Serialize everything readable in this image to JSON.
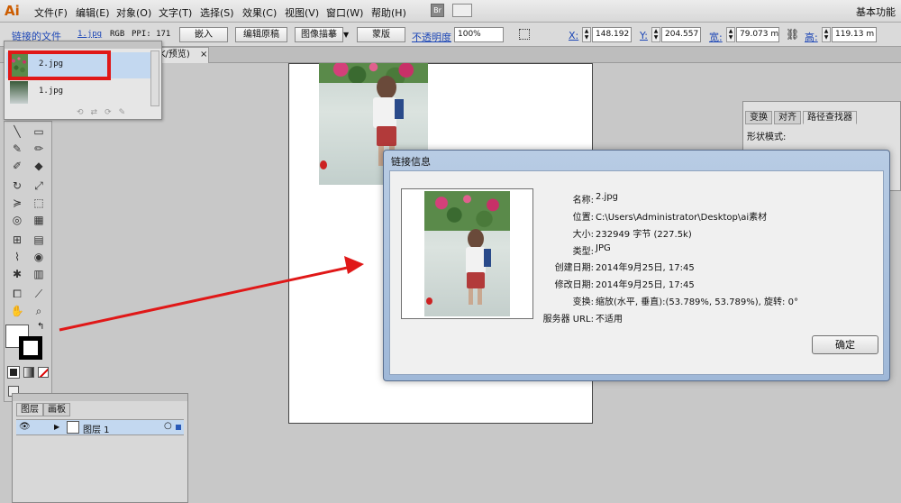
{
  "app": {
    "logo": "Ai"
  },
  "menu": [
    "文件(F)",
    "编辑(E)",
    "对象(O)",
    "文字(T)",
    "选择(S)",
    "效果(C)",
    "视图(V)",
    "窗口(W)",
    "帮助(H)"
  ],
  "workspace": "基本功能",
  "control_bar": {
    "linked_file": "链接的文件",
    "file_name": "1.jpg",
    "color_mode": "RGB",
    "ppi": "PPI: 171",
    "embed": "嵌入",
    "edit_original": "编辑原稿",
    "image_trace": "图像描摹",
    "mask": "蒙版",
    "opacity_label": "不透明度",
    "opacity_value": "100%",
    "x_label": "X:",
    "x_value": "148.192",
    "y_label": "Y:",
    "y_value": "204.557",
    "w_label": "宽:",
    "w_value": "79.073 m",
    "h_label": "高:",
    "h_value": "119.13 m"
  },
  "doc_tab": {
    "label": "K/预览)",
    "close": "×"
  },
  "links_panel": {
    "items": [
      {
        "name": "2.jpg"
      },
      {
        "name": "1.jpg"
      }
    ]
  },
  "pathfinder": {
    "tabs": [
      "变换",
      "对齐",
      "路径查找器"
    ],
    "shape_modes": "形状模式:"
  },
  "layers": {
    "tabs": [
      "图层",
      "画板"
    ],
    "layer_name": "图层 1"
  },
  "dialog": {
    "title": "链接信息",
    "ok": "确定",
    "fields": [
      {
        "label": "名称:",
        "value": "2.jpg"
      },
      {
        "label": "位置:",
        "value": "C:\\Users\\Administrator\\Desktop\\ai素材"
      },
      {
        "label": "大小:",
        "value": "232949 字节 (227.5k)"
      },
      {
        "label": "类型:",
        "value": "JPG"
      },
      {
        "label": "创建日期:",
        "value": "2014年9月25日, 17:45"
      },
      {
        "label": "修改日期:",
        "value": "2014年9月25日, 17:45"
      },
      {
        "label": "变换:",
        "value": "缩放(水平, 垂直):(53.789%, 53.789%), 旋转: 0°"
      },
      {
        "label": "服务器 URL:",
        "value": "不适用"
      }
    ]
  },
  "colors": {
    "highlight": "#e01818",
    "arrow": "#e01818",
    "dialog_frame": "#b8cce4",
    "layer_selected": "#c3d8f0"
  }
}
